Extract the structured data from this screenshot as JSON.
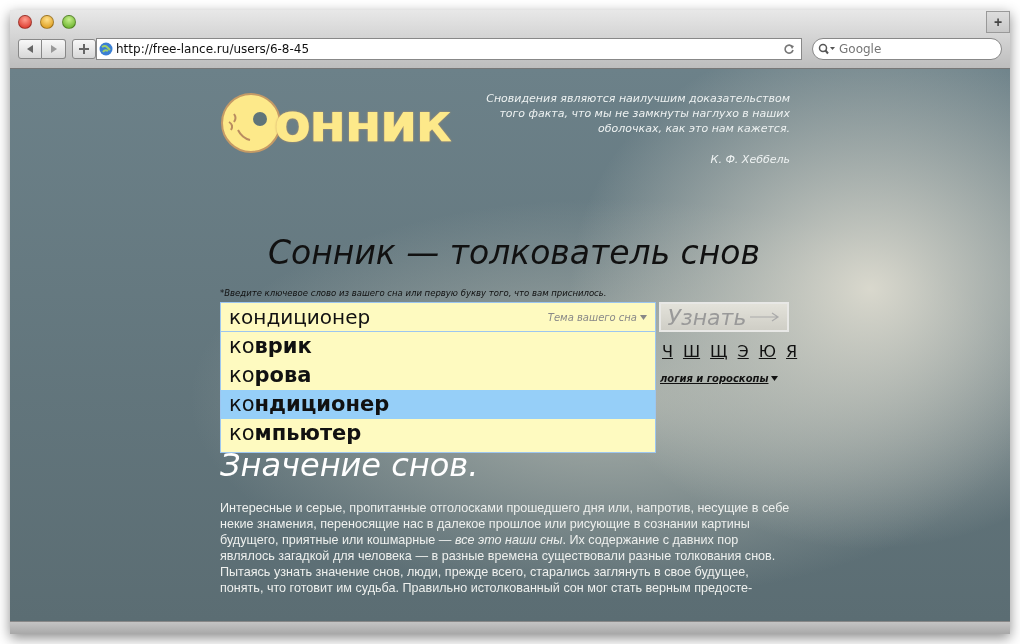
{
  "browser": {
    "url": "http://free-lance.ru/users/6-8-45",
    "search_placeholder": "Google",
    "new_tab": "+"
  },
  "logo": {
    "text": "онник"
  },
  "quote": {
    "text": "Сновидения являются наилучшим доказательством того факта, что мы не замкнуты наглухо в наших оболочках, как это нам кажется.",
    "author": "К. Ф. Хеббель"
  },
  "title": "Сонник — толкователь снов",
  "hint": "*Введите ключевое слово из вашего сна или первую букву того, что вам приснилось.",
  "search": {
    "value": "кондиционер",
    "topic": "Тема вашего сна",
    "button": "Узнать"
  },
  "suggestions": [
    {
      "text": "ко**врик**",
      "selected": false
    },
    {
      "text": "ко**рова**",
      "selected": false
    },
    {
      "text": "ко**ндиционер**",
      "selected": true
    },
    {
      "text": "ко**мпьютер**",
      "selected": false
    }
  ],
  "letters": [
    "Ч",
    "Ш",
    "Щ",
    "Э",
    "Ю",
    "Я"
  ],
  "category_link": "логия и гороскопы",
  "heading": "Значение снов.",
  "paragraphs": [
    "Интересные и серые, пропитанные отголосками прошедшего дня или, напротив, несущие в себе некие знамения, переносящие нас в далекое прошлое или рисующие в сознании картины будущего, приятные или кошмарные — *все это наши сны*. Их содержание с давних пор являлось загадкой для человека — в разные времена существовали разные толкования снов.",
    "Пытаясь узнать значение снов, люди, прежде всего, старались заглянуть в свое будущее, понять, что готовит им судьба. Правильно истолкованный сон мог стать верным предосте-"
  ]
}
